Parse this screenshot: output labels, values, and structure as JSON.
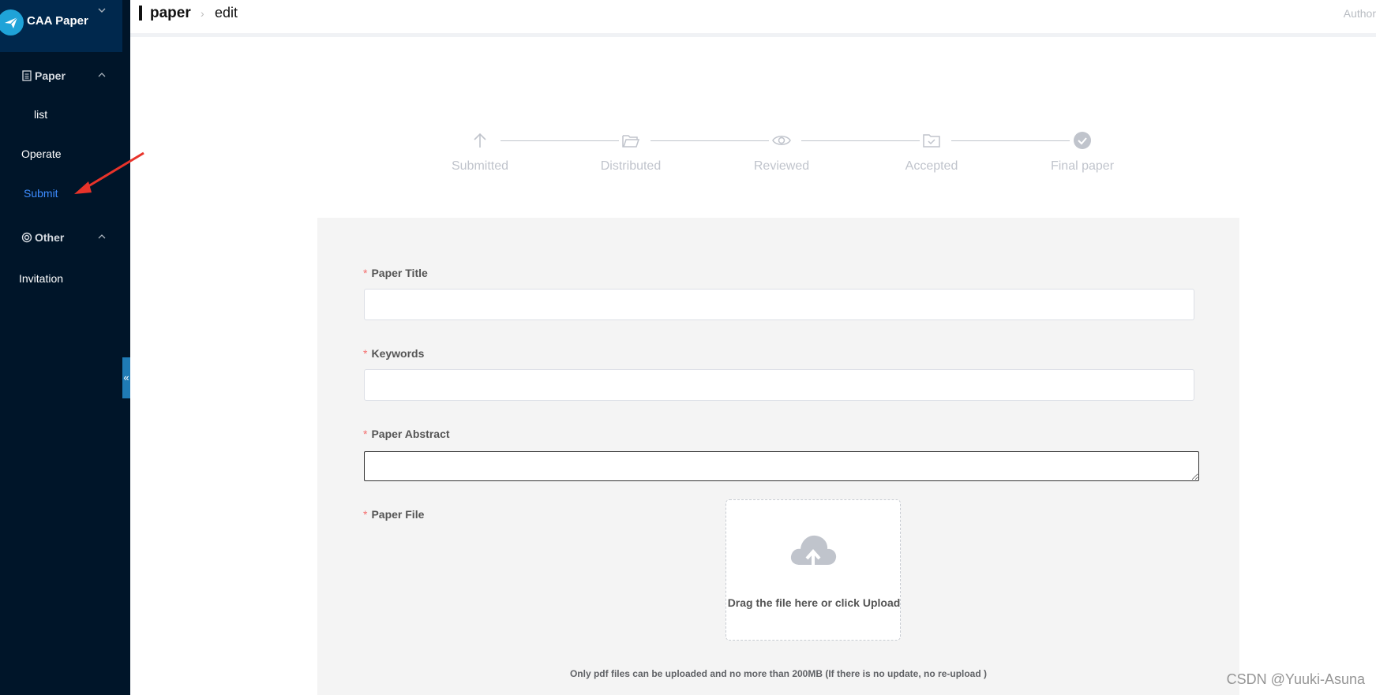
{
  "app": {
    "name": "CAA Paper"
  },
  "sidebar": {
    "groups": [
      {
        "label": "Paper",
        "icon": "document-icon"
      },
      {
        "label": "Other",
        "icon": "circle-icon"
      }
    ],
    "items": [
      {
        "label": "list"
      },
      {
        "label": "Operate"
      },
      {
        "label": "Submit",
        "active": true
      },
      {
        "label": "Invitation"
      }
    ],
    "collapse_glyph": "«"
  },
  "header": {
    "breadcrumb": {
      "root": "paper",
      "separator": "›",
      "leaf": "edit"
    },
    "user": "Author"
  },
  "steps": [
    {
      "label": "Submitted",
      "icon": "arrow-up-icon"
    },
    {
      "label": "Distributed",
      "icon": "folder-open-icon"
    },
    {
      "label": "Reviewed",
      "icon": "eye-icon"
    },
    {
      "label": "Accepted",
      "icon": "folder-check-icon"
    },
    {
      "label": "Final paper",
      "icon": "check-circle-icon"
    }
  ],
  "form": {
    "required_mark": "*",
    "fields": {
      "title": {
        "label": "Paper Title",
        "value": ""
      },
      "keywords": {
        "label": "Keywords",
        "value": ""
      },
      "abstract": {
        "label": "Paper Abstract",
        "value": ""
      },
      "file": {
        "label": "Paper File"
      }
    },
    "upload": {
      "text": "Drag the file here or click Upload",
      "icon": "cloud-upload-icon"
    },
    "hint": "Only pdf files can be uploaded and no more than 200MB (If there is no update, no re-upload )"
  },
  "watermark": "CSDN @Yuuki-Asuna",
  "colors": {
    "sidebar": "#001529",
    "brand": "#00284d",
    "active": "#3d8cff",
    "step": "#c0c4cc",
    "required": "#f56c6c",
    "annotation": "#e8332a"
  }
}
